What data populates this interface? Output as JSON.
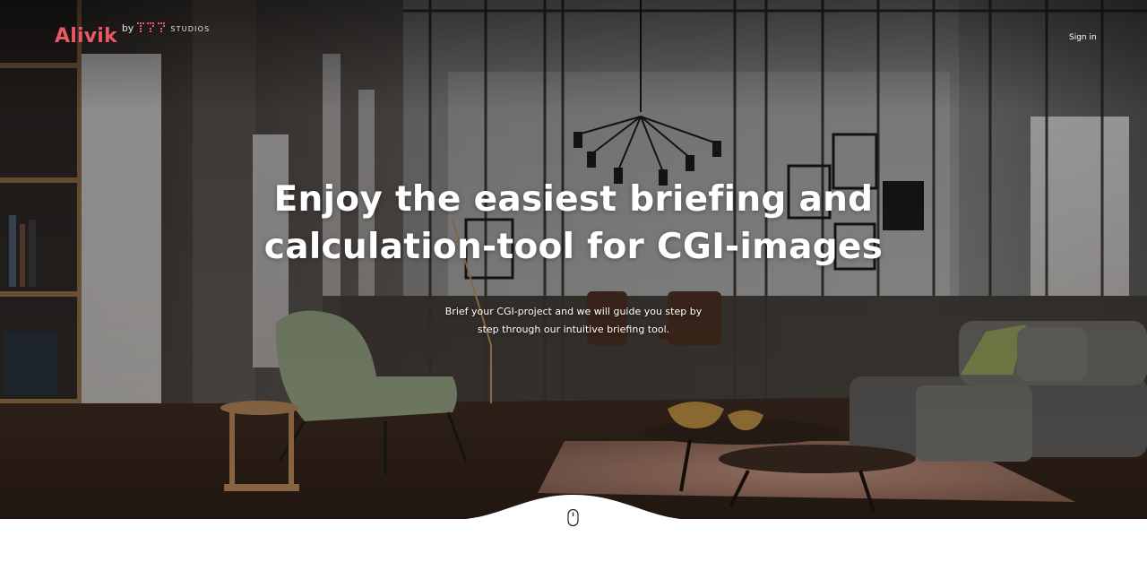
{
  "brand": {
    "name": "Alivik",
    "by": "by",
    "studio_mark": "studio-logo-mark",
    "studio_label": "STUDIOS",
    "accent": "#ea5863"
  },
  "nav": {
    "sign_in": "Sign in"
  },
  "hero": {
    "headline_lines": [
      "Enjoy the easiest briefing and",
      "calculation-tool for CGI-images"
    ],
    "sub_lines": [
      "Brief your CGI-project and we will guide you step by",
      "step through our intuitive briefing tool."
    ],
    "background": "interior-render-photo",
    "scroll_icon": "mouse-scroll-icon"
  }
}
